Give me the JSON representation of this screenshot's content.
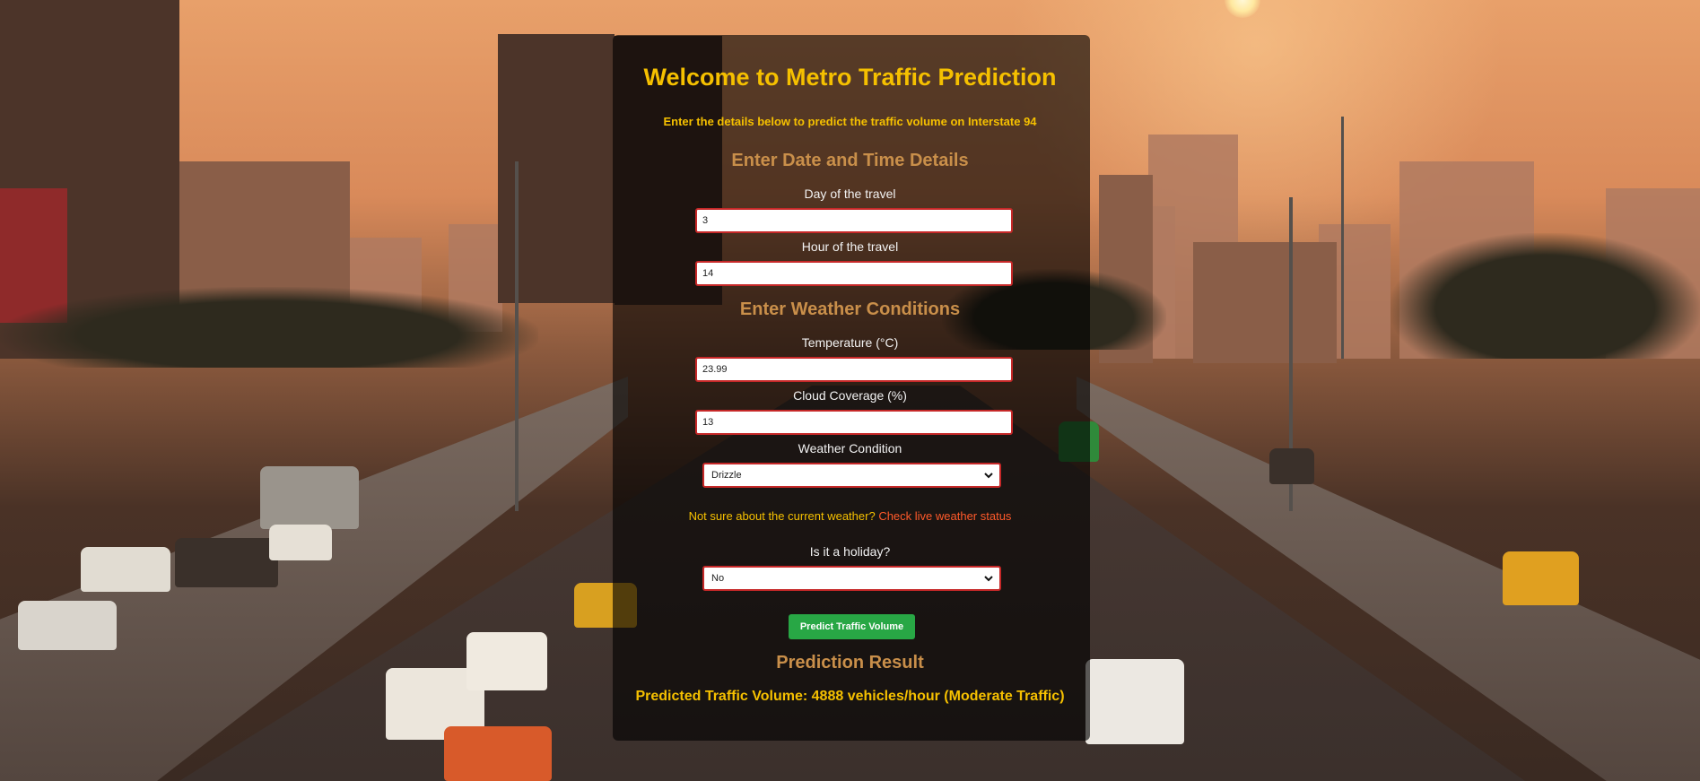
{
  "header": {
    "title": "Welcome to Metro Traffic Prediction",
    "subtitle": "Enter the details below to predict the traffic volume on Interstate 94"
  },
  "date_time": {
    "heading": "Enter Date and Time Details",
    "day_label": "Day of the travel",
    "day_value": "3",
    "hour_label": "Hour of the travel",
    "hour_value": "14"
  },
  "weather": {
    "heading": "Enter Weather Conditions",
    "temperature_label": "Temperature (°C)",
    "temperature_value": "23.99",
    "cloud_label": "Cloud Coverage (%)",
    "cloud_value": "13",
    "condition_label": "Weather Condition",
    "condition_selected": "Drizzle",
    "tip_text": "Not sure about the current weather?",
    "tip_link": "Check live weather status"
  },
  "holiday": {
    "label": "Is it a holiday?",
    "selected": "No"
  },
  "actions": {
    "predict_label": "Predict Traffic Volume"
  },
  "result": {
    "heading": "Prediction Result",
    "text": "Predicted Traffic Volume: 4888 vehicles/hour (Moderate Traffic)"
  },
  "colors": {
    "accent": "#f5c000",
    "section_heading": "#c98f4a",
    "link": "#ff5a2a",
    "button": "#28a745",
    "input_border": "#c62828"
  },
  "icons": {
    "select_chevron": "chevron-down-icon"
  }
}
